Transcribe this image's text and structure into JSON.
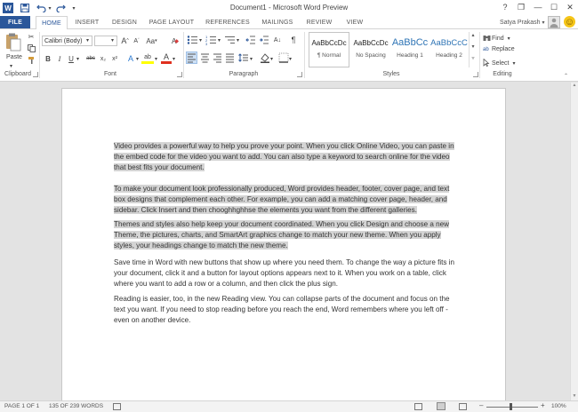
{
  "window": {
    "title": "Document1 - Microsoft Word Preview"
  },
  "quick_access": {
    "word_icon": "W",
    "save_icon": "save-icon",
    "undo_icon": "undo-icon",
    "redo_icon": "redo-icon",
    "customize_icon": "▾"
  },
  "window_controls": {
    "help": "?",
    "restore": "❐",
    "minimize": "—",
    "maximize": "☐",
    "close": "✕"
  },
  "tabs": [
    "FILE",
    "HOME",
    "INSERT",
    "DESIGN",
    "PAGE LAYOUT",
    "REFERENCES",
    "MAILINGS",
    "REVIEW",
    "VIEW"
  ],
  "active_tab": "HOME",
  "user": {
    "name": "Satya Prakash",
    "avatar_icon": "person-icon",
    "smiley": "☺"
  },
  "ribbon": {
    "clipboard": {
      "label": "Clipboard",
      "paste": "Paste"
    },
    "font": {
      "label": "Font",
      "font_name": "Calibri (Body)",
      "font_size": "",
      "grow": "A",
      "shrink": "A",
      "case": "Aa",
      "clear": "A",
      "bold": "B",
      "italic": "I",
      "underline": "U",
      "strike": "abc",
      "subscript": "x₂",
      "superscript": "x²",
      "effects": "A",
      "highlight": "ab",
      "color": "A"
    },
    "paragraph": {
      "label": "Paragraph",
      "show_marks": "¶"
    },
    "styles": {
      "label": "Styles",
      "items": [
        {
          "preview": "AaBbCcDc",
          "name": "¶ Normal"
        },
        {
          "preview": "AaBbCcDc",
          "name": "No Spacing"
        },
        {
          "preview": "AaBbCc",
          "name": "Heading 1"
        },
        {
          "preview": "AaBbCcC",
          "name": "Heading 2"
        }
      ]
    },
    "editing": {
      "label": "Editing",
      "find": "Find",
      "replace": "Replace",
      "select": "Select"
    }
  },
  "document": {
    "paragraphs": [
      {
        "text": "Video provides a powerful way to help you prove your point. When you click Online Video, you can paste in the embed code for the video you want to add. You can also type a keyword to search online for the video that best fits your document.",
        "selected": true
      },
      {
        "text": "To make your document look professionally produced, Word provides header, footer, cover page, and text box designs that complement each other. For example, you can add a matching cover page, header, and sidebar. Click Insert and then chooghhghhse the elements you want from the different galleries.",
        "selected": true
      },
      {
        "text": "Themes and styles also help keep your document coordinated. When you click Design and choose a new Theme, the pictures, charts, and SmartArt graphics change to match your new theme. When you apply styles, your headings change to match the new theme.",
        "selected": true
      },
      {
        "text": "Save time in Word with new buttons that show up where you need them. To change the way a picture fits in your document, click it and a button for layout options appears next to it. When you work on a table, click where you want to add a row or a column, and then click the plus sign.",
        "selected": false
      },
      {
        "text": "Reading is easier, too, in the new Reading view. You can collapse parts of the document and focus on the text you want. If you need to stop reading before you reach the end, Word remembers where you left off - even on another device.",
        "selected": false
      }
    ]
  },
  "status": {
    "page": "PAGE 1 OF 1",
    "words": "135 OF 239 WORDS",
    "zoom_minus": "–",
    "zoom_plus": "+",
    "zoom": "100%"
  }
}
